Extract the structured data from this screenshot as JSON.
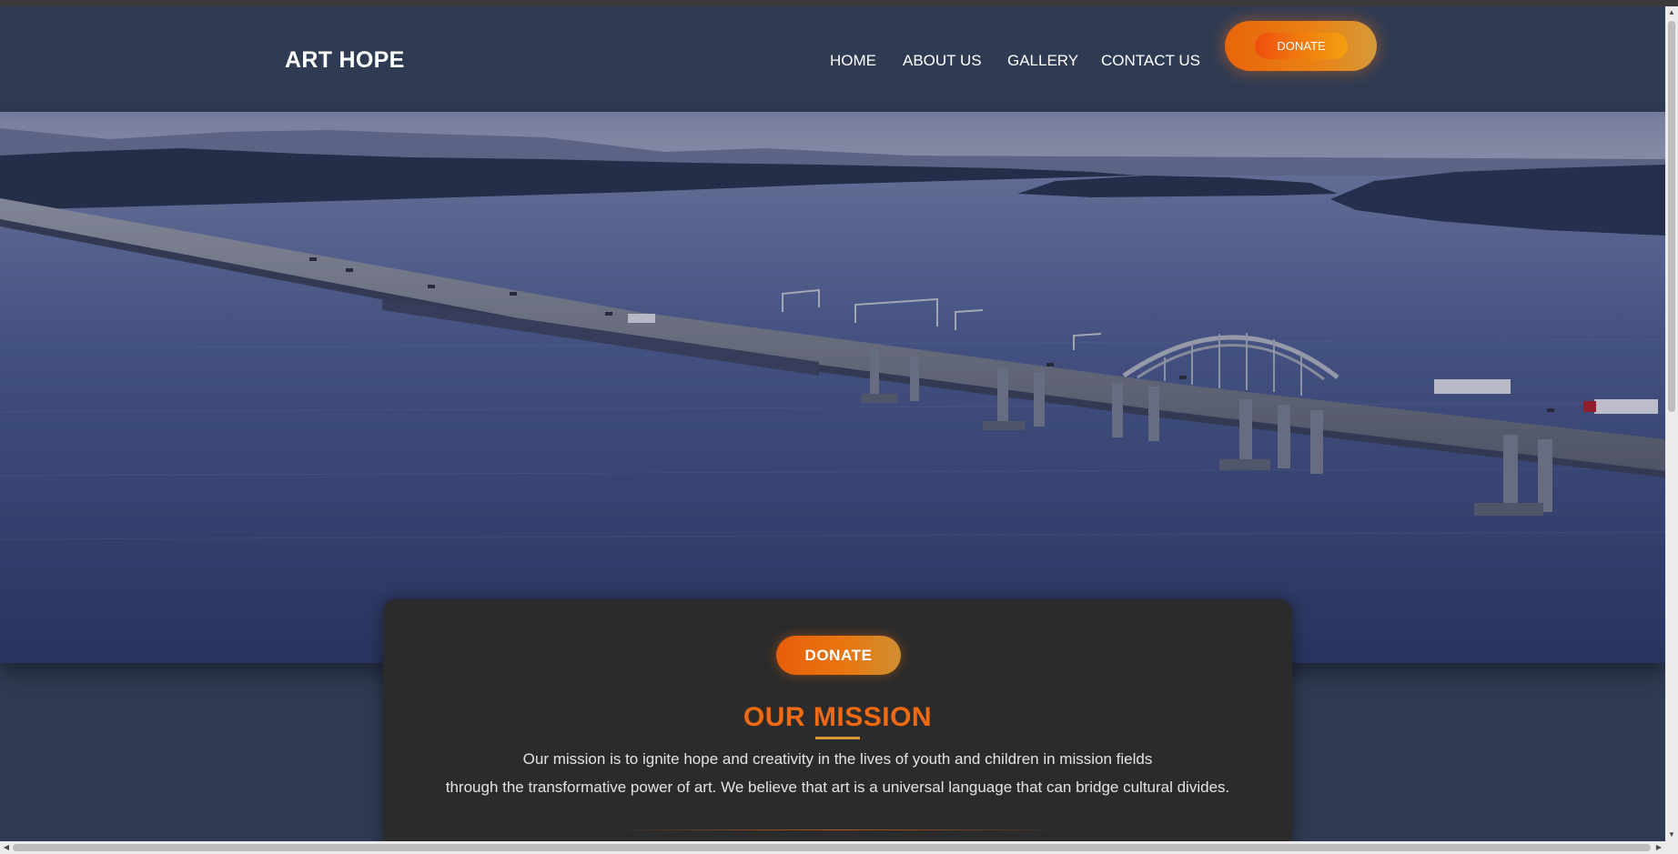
{
  "site": {
    "logo": "ART HOPE"
  },
  "nav": {
    "items": [
      {
        "label": "HOME"
      },
      {
        "label": "ABOUT US"
      },
      {
        "label": "GALLERY"
      },
      {
        "label": "CONTACT US"
      }
    ],
    "donate_label": "DONATE"
  },
  "hero": {
    "image": "aerial-bridge-over-lake"
  },
  "mission": {
    "donate_label": "DONATE",
    "title": "OUR MISSION",
    "line1": "Our mission is to ignite hope and creativity in the lives of youth and children in mission fields",
    "line2": "through the transformative power of art. We believe that art is a universal language that can bridge cultural divides."
  },
  "colors": {
    "header_bg": "#2f3b53",
    "accent_orange": "#f06a14",
    "card_bg": "#2b2b2b"
  },
  "icons": {
    "scroll_up": "triangle-up-icon",
    "scroll_down": "triangle-down-icon",
    "scroll_left": "triangle-left-icon",
    "scroll_right": "triangle-right-icon"
  }
}
